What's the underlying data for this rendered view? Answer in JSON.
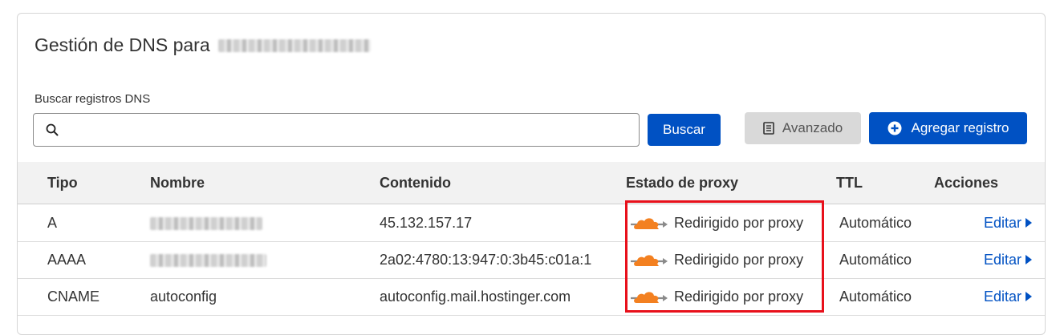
{
  "header": {
    "title": "Gestión de DNS para"
  },
  "search": {
    "label": "Buscar registros DNS",
    "placeholder": "",
    "value": "",
    "search_button": "Buscar",
    "advanced_button": "Avanzado",
    "add_button": "Agregar registro"
  },
  "table": {
    "columns": [
      "Tipo",
      "Nombre",
      "Contenido",
      "Estado de proxy",
      "TTL",
      "Acciones"
    ],
    "rows": [
      {
        "type": "A",
        "name": "",
        "content": "45.132.157.17",
        "proxy": "Redirigido por proxy",
        "ttl": "Automático",
        "action": "Editar"
      },
      {
        "type": "AAAA",
        "name": "",
        "content": "2a02:4780:13:947:0:3b45:c01a:1",
        "proxy": "Redirigido por proxy",
        "ttl": "Automático",
        "action": "Editar"
      },
      {
        "type": "CNAME",
        "name": "autoconfig",
        "content": "autoconfig.mail.hostinger.com",
        "proxy": "Redirigido por proxy",
        "ttl": "Automático",
        "action": "Editar"
      }
    ]
  },
  "colors": {
    "primary": "#0051c3",
    "cloud": "#f38020",
    "highlight": "#e8101b"
  },
  "icons": {
    "search": "search-icon",
    "advanced": "document-icon",
    "add": "plus-circle-icon",
    "proxy": "cloud-proxied-icon",
    "edit": "caret-right-icon"
  }
}
